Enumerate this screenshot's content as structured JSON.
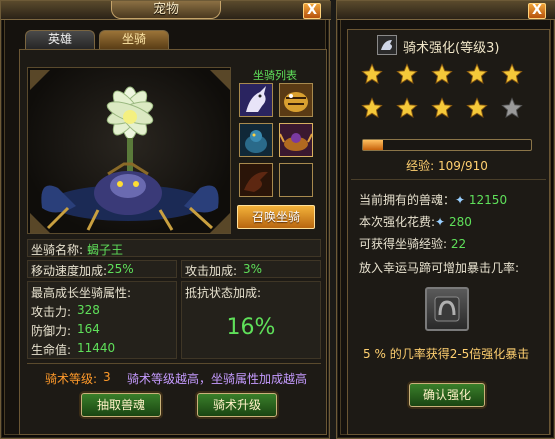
{
  "pet_window": {
    "title": "宠物",
    "close_label": "X",
    "tabs": [
      {
        "label": "英雄",
        "active": false
      },
      {
        "label": "坐骑",
        "active": true
      }
    ],
    "mount_list_title": "坐骑列表",
    "summon_button": "召唤坐骑",
    "mount_name_label": "坐骑名称:",
    "mount_name_value": "蝎子王",
    "move_speed_label": "移动速度加成:",
    "move_speed_value": "25%",
    "attack_bonus_label": "攻击加成:",
    "attack_bonus_value": "3%",
    "max_growth_label": "最高成长坐骑属性:",
    "attack_power_label": "攻击力:",
    "attack_power_value": "328",
    "defense_label": "防御力:",
    "defense_value": "164",
    "hp_label": "生命值:",
    "hp_value": "11440",
    "resist_label": "抵抗状态加成:",
    "resist_value": "16%",
    "riding_level_label": "骑术等级:",
    "riding_level_value": "3",
    "riding_hint": "骑术等级越高，坐骑属性加成越高",
    "extract_button": "抽取兽魂",
    "upgrade_button": "骑术升级"
  },
  "riding_window": {
    "close_label": "X",
    "title": "骑术强化(等级3)",
    "stars_total": 10,
    "stars_filled": 9,
    "exp_label": "经验:",
    "exp_value": "109/910",
    "exp_fraction": 0.12,
    "current_soul_label": "当前拥有的兽魂：",
    "current_soul_value": "12150",
    "cost_label": "本次强化花费:",
    "cost_value": "280",
    "gain_exp_label": "可获得坐骑经验:",
    "gain_exp_value": "22",
    "lucky_hint": "放入幸运马蹄可增加暴击几率:",
    "crit_pct": "5",
    "crit_pct_suffix": "%",
    "crit_text": "的几率获得2-5倍强化暴击",
    "confirm_button": "确认强化"
  },
  "colors": {
    "accent_green": "#5fe05a",
    "gold": "#f3b23a",
    "frame": "#6d5a37",
    "hint_purple": "#c59bff",
    "level_orange": "#ff9a2a"
  }
}
